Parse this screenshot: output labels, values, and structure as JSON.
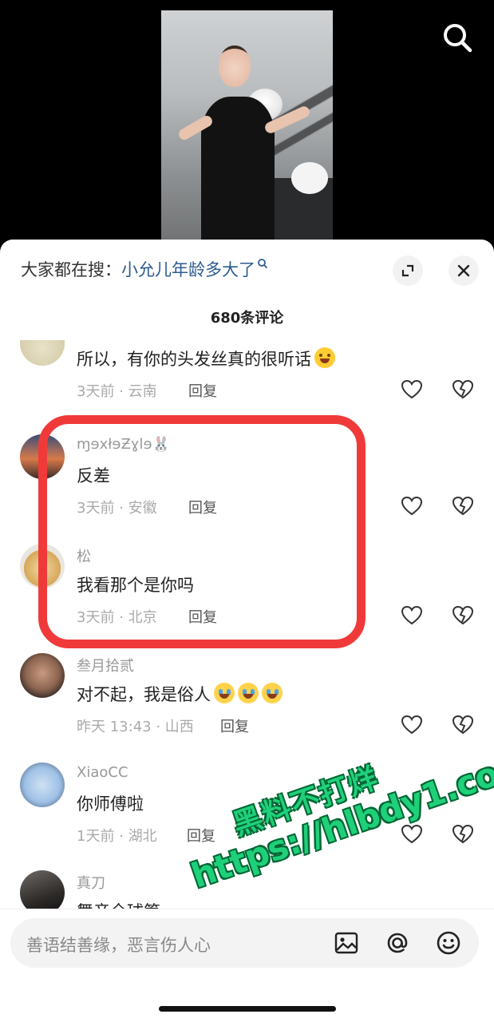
{
  "header": {
    "search_icon": "search-icon"
  },
  "sheet": {
    "suggest_prefix": "大家都在搜：",
    "suggest_keyword": "小允儿年龄多大了",
    "expand_icon": "expand-icon",
    "close_icon": "close-icon",
    "comment_count": "680条评论"
  },
  "comments": [
    {
      "name": "",
      "text": "所以，有你的头发丝真的很听话",
      "emoji": "laugh-cry",
      "meta": "3天前 · 云南",
      "reply": "回复"
    },
    {
      "name": "ɱɘxłɘƵɣlɘ🐰",
      "text": "反差",
      "meta": "3天前 · 安徽",
      "reply": "回复"
    },
    {
      "name": "松",
      "text": "我看那个是你吗",
      "meta": "3天前 · 北京",
      "reply": "回复"
    },
    {
      "name": "叁月拾贰",
      "text": "对不起，我是俗人",
      "emoji_count": 3,
      "meta": "昨天 13:43 · 山西",
      "reply": "回复"
    },
    {
      "name": "XiaoCC",
      "text": "你师傅啦",
      "meta": "1天前 · 湖北",
      "reply": "回复"
    },
    {
      "name": "真刀",
      "text": "舞音全球筹",
      "meta": "",
      "reply": ""
    }
  ],
  "input": {
    "placeholder": "善语结善缘，恶言伤人心",
    "image_icon": "image-icon",
    "at_icon": "at-icon",
    "emoji_icon": "emoji-icon"
  },
  "watermark": {
    "line1": "黑料不打烊",
    "line2": "https://hlbdy1.com"
  },
  "colors": {
    "highlight_border": "#f03a3a",
    "keyword": "#2c5b8f",
    "watermark": "#1fd07a"
  }
}
